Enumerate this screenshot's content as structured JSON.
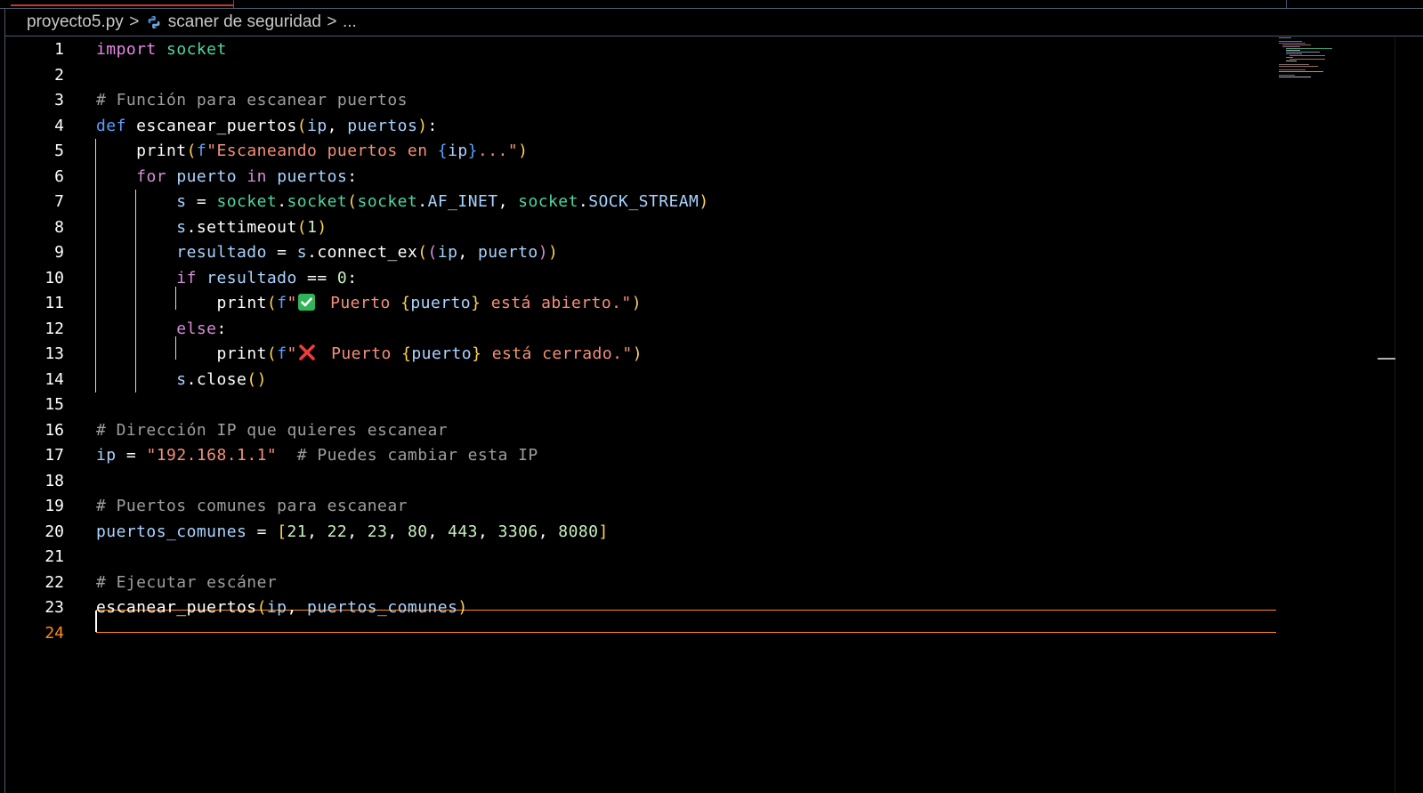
{
  "breadcrumb": {
    "file": "proyecto5.py",
    "symbol": "scaner de seguridad",
    "more": "...",
    "separator": ">",
    "symbol_icon": "python-icon"
  },
  "editor": {
    "current_line": 24,
    "line_numbers": [
      "1",
      "2",
      "3",
      "4",
      "5",
      "6",
      "7",
      "8",
      "9",
      "10",
      "11",
      "12",
      "13",
      "14",
      "15",
      "16",
      "17",
      "18",
      "19",
      "20",
      "21",
      "22",
      "23",
      "24"
    ],
    "tokens": {
      "l1_import": "import",
      "l1_socket": "socket",
      "l3_comment": "# Función para escanear puertos",
      "l4_def": "def",
      "l4_fn": "escanear_puertos",
      "l4_ip": "ip",
      "l4_puertos": "puertos",
      "l5_print": "print",
      "l5_f": "f",
      "l5_str_a": "\"Escaneando puertos en ",
      "l5_ip": "ip",
      "l5_str_b": "...\"",
      "l6_for": "for",
      "l6_puerto": "puerto",
      "l6_in": "in",
      "l6_puertos": "puertos",
      "l7_s": "s",
      "l7_socket_mod": "socket",
      "l7_socket_fn": "socket",
      "l7_socket_a": "socket",
      "l7_af": "AF_INET",
      "l7_socket_b": "socket",
      "l7_sock": "SOCK_STREAM",
      "l8_s": "s",
      "l8_fn": "settimeout",
      "l8_num": "1",
      "l9_res": "resultado",
      "l9_s": "s",
      "l9_fn": "connect_ex",
      "l9_ip": "ip",
      "l9_puerto": "puerto",
      "l10_if": "if",
      "l10_res": "resultado",
      "l10_num": "0",
      "l11_print": "print",
      "l11_f": "f",
      "l11_q": "\"",
      "l11_str_a": " Puerto ",
      "l11_puerto": "puerto",
      "l11_str_b": " está abierto.\"",
      "l12_else": "else",
      "l13_print": "print",
      "l13_f": "f",
      "l13_q": "\"",
      "l13_str_a": " Puerto ",
      "l13_puerto": "puerto",
      "l13_str_b": " está cerrado.\"",
      "l14_s": "s",
      "l14_fn": "close",
      "l16_comment": "# Dirección IP que quieres escanear",
      "l17_ip": "ip",
      "l17_str": "\"192.168.1.1\"",
      "l17_comment": "# Puedes cambiar esta IP",
      "l19_comment": "# Puertos comunes para escanear",
      "l20_var": "puertos_comunes",
      "l20_n1": "21",
      "l20_n2": "22",
      "l20_n3": "23",
      "l20_n4": "80",
      "l20_n5": "443",
      "l20_n6": "3306",
      "l20_n7": "8080",
      "l22_comment": "# Ejecutar escáner",
      "l23_fn": "escanear_puertos",
      "l23_ip": "ip",
      "l23_var": "puertos_comunes"
    }
  },
  "colors": {
    "background": "#000000",
    "current_line_border": "#ff8c1a",
    "tab_active_accent": "#c0392b"
  }
}
